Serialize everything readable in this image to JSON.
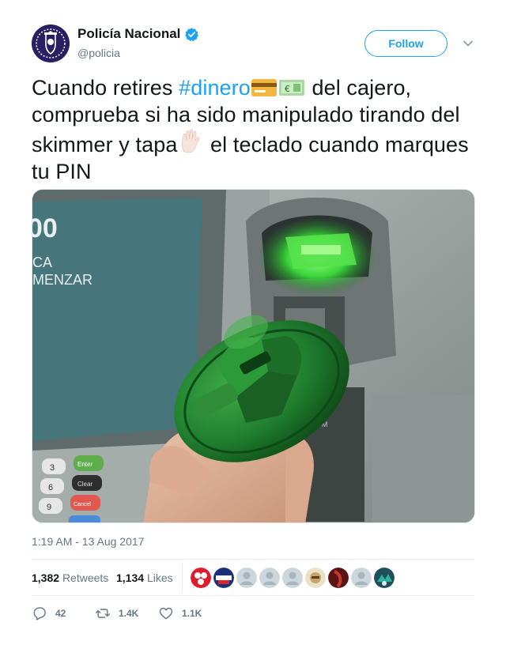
{
  "author": {
    "display_name": "Policía Nacional",
    "handle": "@policia",
    "verified": true,
    "avatar_icon": "policia-nacional-badge-icon"
  },
  "follow_label": "Follow",
  "tweet": {
    "text_before_hashtag": "Cuando retires ",
    "hashtag": "#dinero",
    "emoji_1": "credit-card-emoji",
    "emoji_2": "euro-banknote-emoji",
    "text_mid": " del cajero, comprueba si ha sido manipulado tirando del skimmer y tapa",
    "emoji_3": "raised-hand-emoji",
    "text_end": " el teclado cuando marques tu PIN"
  },
  "media": {
    "atm_screen_text": [
      "00",
      "CA",
      "MENZAR"
    ],
    "keypad_keys": [
      "3",
      "Enter",
      "6",
      "Clear",
      "9",
      "Cancel"
    ]
  },
  "timestamp": "1:19 AM - 13 Aug 2017",
  "stats": {
    "retweets_count": "1,382",
    "retweets_label": "Retweets",
    "likes_count": "1,134",
    "likes_label": "Likes"
  },
  "actions": {
    "reply_count": "42",
    "retweet_count": "1.4K",
    "like_count": "1.1K"
  },
  "colors": {
    "link_blue": "#1da1f2",
    "secondary_text": "#657786",
    "skimmer_green": "#1f7d2e"
  }
}
